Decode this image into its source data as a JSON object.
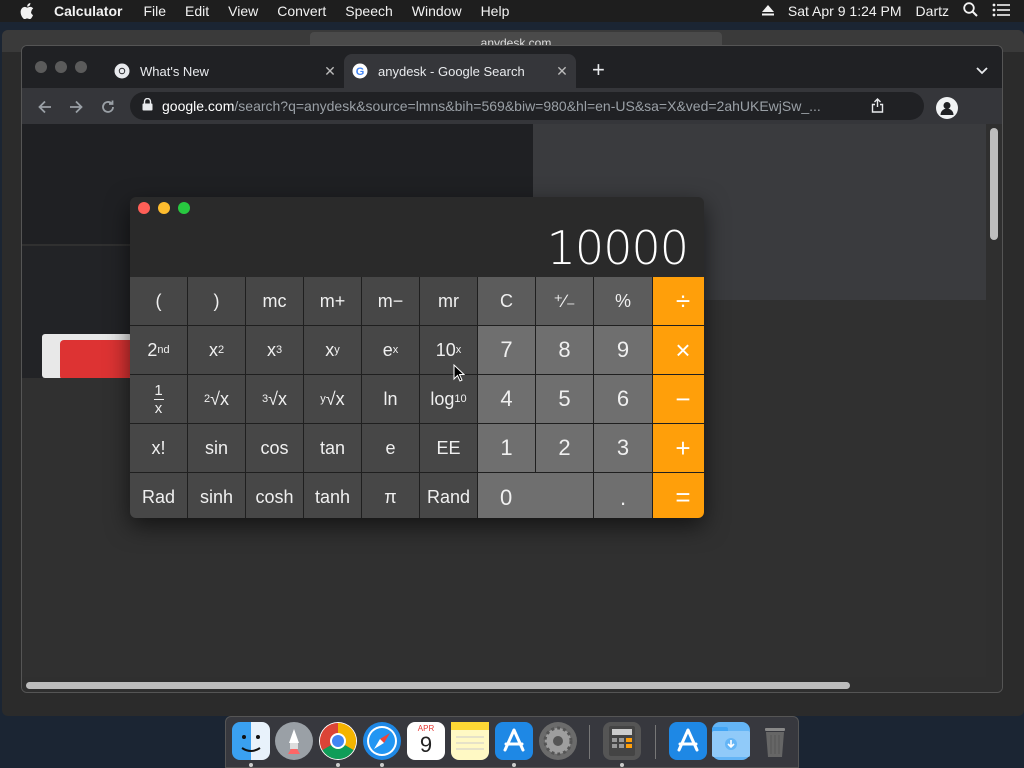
{
  "menubar": {
    "app_name": "Calculator",
    "items": [
      "File",
      "Edit",
      "View",
      "Convert",
      "Speech",
      "Window",
      "Help"
    ],
    "datetime": "Sat Apr 9  1:24 PM",
    "user": "Dartz"
  },
  "background_window": {
    "url": "anydesk.com"
  },
  "browser": {
    "tabs": [
      {
        "title": "What's New",
        "active": false
      },
      {
        "title": "anydesk - Google Search",
        "active": true
      }
    ],
    "url_host": "google.com",
    "url_path": "/search?q=anydesk&source=lmns&bih=569&biw=980&hl=en-US&sa=X&ved=2ahUKEwjSw_..."
  },
  "calculator": {
    "display": "10000",
    "keys": {
      "r1": [
        "(",
        ")",
        "mc",
        "m+",
        "m−",
        "mr",
        "C",
        "⁺∕₋",
        "%",
        "÷"
      ],
      "r2_fn": [
        "2nd",
        "x2",
        "x3",
        "xy",
        "ex",
        "10x"
      ],
      "r2_num": [
        "7",
        "8",
        "9",
        "×"
      ],
      "r3_fn": [
        "1/x",
        "2√x",
        "3√x",
        "y√x",
        "ln",
        "log10"
      ],
      "r3_num": [
        "4",
        "5",
        "6",
        "−"
      ],
      "r4": [
        "x!",
        "sin",
        "cos",
        "tan",
        "e",
        "EE",
        "1",
        "2",
        "3",
        "+"
      ],
      "r5": [
        "Rad",
        "sinh",
        "cosh",
        "tanh",
        "π",
        "Rand",
        "0",
        ".",
        "="
      ]
    }
  },
  "dock": {
    "apps": [
      "finder",
      "launchpad",
      "chrome",
      "safari",
      "calendar",
      "notes",
      "app-store",
      "system-preferences",
      "calculator",
      "app-store-folder",
      "downloads-folder",
      "trash"
    ],
    "calendar_day": "9",
    "calendar_month": "APR"
  },
  "colors": {
    "operator": "#ff9f0a",
    "menubar": "#1e1e1e",
    "tabstrip": "#202124"
  }
}
